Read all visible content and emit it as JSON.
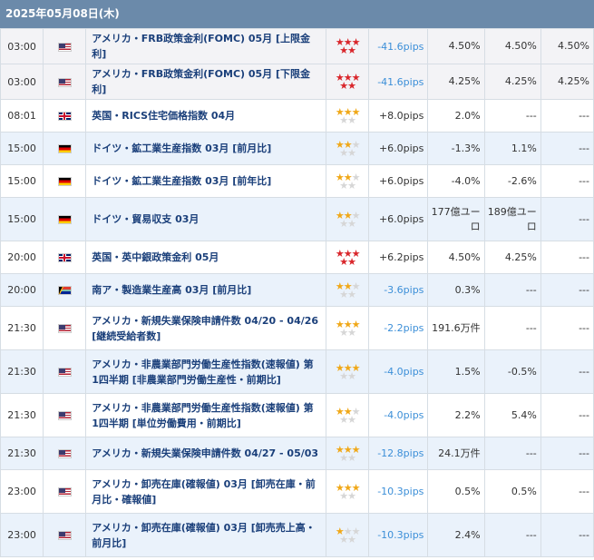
{
  "header": {
    "date": "2025年05月08日(木)"
  },
  "colors": {
    "header_bg": "#6b8aaa",
    "star_high": "#d9262b",
    "star_mid": "#f0a818",
    "star_off": "#d6d6d6",
    "negative_pips": "#3c8fd8"
  },
  "rows": [
    {
      "time": "03:00",
      "flag": "us-flag-icon",
      "name": "アメリカ・FRB政策金利(FOMC) 05月 [上限金利]",
      "stars": 5,
      "pips": "-41.6pips",
      "result": "4.50%",
      "forecast": "4.50%",
      "previous": "4.50%"
    },
    {
      "time": "03:00",
      "flag": "us-flag-icon",
      "name": "アメリカ・FRB政策金利(FOMC) 05月 [下限金利]",
      "stars": 5,
      "pips": "-41.6pips",
      "result": "4.25%",
      "forecast": "4.25%",
      "previous": "4.25%"
    },
    {
      "time": "08:01",
      "flag": "gb-flag-icon",
      "name": "英国・RICS住宅価格指数 04月",
      "stars": 3,
      "pips": "+8.0pips",
      "result": "2.0%",
      "forecast": "---",
      "previous": "---"
    },
    {
      "time": "15:00",
      "flag": "de-flag-icon",
      "name": "ドイツ・鉱工業生産指数 03月 [前月比]",
      "stars": 2,
      "pips": "+6.0pips",
      "result": "-1.3%",
      "forecast": "1.1%",
      "previous": "---"
    },
    {
      "time": "15:00",
      "flag": "de-flag-icon",
      "name": "ドイツ・鉱工業生産指数 03月 [前年比]",
      "stars": 2,
      "pips": "+6.0pips",
      "result": "-4.0%",
      "forecast": "-2.6%",
      "previous": "---"
    },
    {
      "time": "15:00",
      "flag": "de-flag-icon",
      "name": "ドイツ・貿易収支 03月",
      "stars": 2,
      "pips": "+6.0pips",
      "result": "177億ユーロ",
      "forecast": "189億ユーロ",
      "previous": "---"
    },
    {
      "time": "20:00",
      "flag": "gb-flag-icon",
      "name": "英国・英中銀政策金利 05月",
      "stars": 5,
      "pips": "+6.2pips",
      "result": "4.50%",
      "forecast": "4.25%",
      "previous": "---"
    },
    {
      "time": "20:00",
      "flag": "za-flag-icon",
      "name": "南ア・製造業生産高 03月 [前月比]",
      "stars": 2,
      "pips": "-3.6pips",
      "result": "0.3%",
      "forecast": "---",
      "previous": "---"
    },
    {
      "time": "21:30",
      "flag": "us-flag-icon",
      "name": "アメリカ・新規失業保険申請件数 04/20 - 04/26 [継続受給者数]",
      "stars": 3,
      "pips": "-2.2pips",
      "result": "191.6万件",
      "forecast": "---",
      "previous": "---"
    },
    {
      "time": "21:30",
      "flag": "us-flag-icon",
      "name": "アメリカ・非農業部門労働生産性指数(速報値) 第1四半期 [非農業部門労働生産性・前期比]",
      "stars": 3,
      "pips": "-4.0pips",
      "result": "1.5%",
      "forecast": "-0.5%",
      "previous": "---"
    },
    {
      "time": "21:30",
      "flag": "us-flag-icon",
      "name": "アメリカ・非農業部門労働生産性指数(速報値) 第1四半期 [単位労働費用・前期比]",
      "stars": 2,
      "pips": "-4.0pips",
      "result": "2.2%",
      "forecast": "5.4%",
      "previous": "---"
    },
    {
      "time": "21:30",
      "flag": "us-flag-icon",
      "name": "アメリカ・新規失業保険申請件数 04/27 - 05/03",
      "stars": 3,
      "pips": "-12.8pips",
      "result": "24.1万件",
      "forecast": "---",
      "previous": "---"
    },
    {
      "time": "23:00",
      "flag": "us-flag-icon",
      "name": "アメリカ・卸売在庫(確報値) 03月 [卸売在庫・前月比・確報値]",
      "stars": 3,
      "pips": "-10.3pips",
      "result": "0.5%",
      "forecast": "0.5%",
      "previous": "---"
    },
    {
      "time": "23:00",
      "flag": "us-flag-icon",
      "name": "アメリカ・卸売在庫(確報値) 03月 [卸売売上高・前月比]",
      "stars": 1,
      "pips": "-10.3pips",
      "result": "2.4%",
      "forecast": "---",
      "previous": "---"
    }
  ]
}
